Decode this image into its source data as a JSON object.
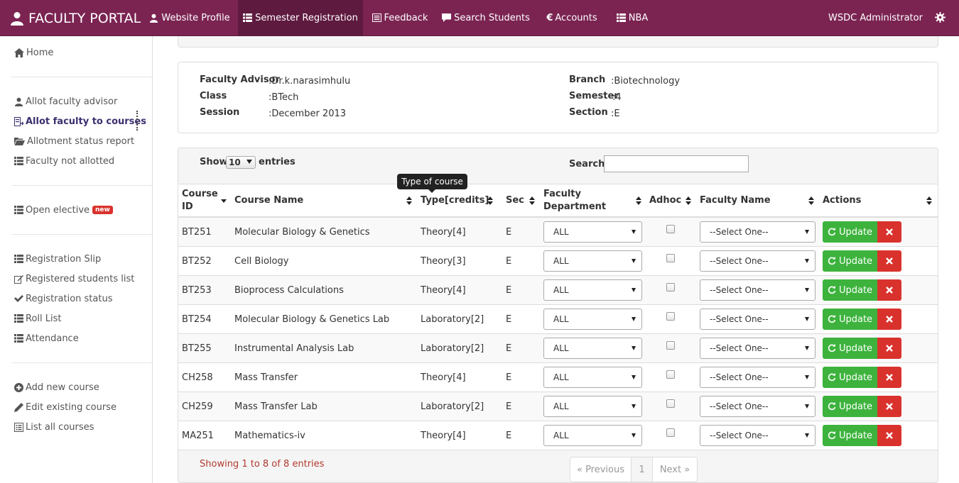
{
  "navbar": {
    "brand": "FACULTY PORTAL",
    "items": [
      {
        "label": "Website Profile",
        "icon": "user-icon"
      },
      {
        "label": "Semester Registration",
        "icon": "list-icon",
        "active": true
      },
      {
        "label": "Feedback",
        "icon": "form-icon"
      },
      {
        "label": "Search Students",
        "icon": "comment-icon"
      },
      {
        "label": "Accounts",
        "icon": "euro-icon"
      },
      {
        "label": "NBA",
        "icon": "list-icon"
      }
    ],
    "user": "WSDC Administrator",
    "accent": "#7b2452"
  },
  "sidebar": {
    "items": [
      {
        "label": "Home",
        "icon": "home-icon"
      },
      {
        "label": "Allot faculty advisor",
        "icon": "user-icon"
      },
      {
        "label": "Allot faculty to courses",
        "icon": "assign-icon",
        "active": true
      },
      {
        "label": "Allotment status report",
        "icon": "folder-open-icon"
      },
      {
        "label": "Faculty not allotted",
        "icon": "list-icon"
      },
      {
        "label": "Open elective",
        "icon": "list-icon",
        "badge": "new"
      },
      {
        "label": "Registration Slip",
        "icon": "list-icon"
      },
      {
        "label": "Registered students list",
        "icon": "edit-icon"
      },
      {
        "label": "Registration status",
        "icon": "check-icon"
      },
      {
        "label": "Roll List",
        "icon": "list-icon"
      },
      {
        "label": "Attendance",
        "icon": "list-icon"
      },
      {
        "label": "Add new course",
        "icon": "plus-circle-icon"
      },
      {
        "label": "Edit existing course",
        "icon": "pencil-icon"
      },
      {
        "label": "List all courses",
        "icon": "list-alt-icon"
      }
    ]
  },
  "info": {
    "faculty_advisor_label": "Faculty Advisor",
    "faculty_advisor": ":Dr.k.narasimhulu",
    "class_label": "Class",
    "class": ":BTech",
    "session_label": "Session",
    "session": ":December 2013",
    "branch_label": "Branch",
    "branch": ":Biotechnology",
    "semester_label": "Semester",
    "semester": ":4",
    "section_label": "Section",
    "section": ":E"
  },
  "table": {
    "show_label": "Show",
    "entries_value": "10",
    "entries_label": "entries",
    "search_label": "Search:",
    "search_value": "",
    "tooltip": "Type of course",
    "columns": [
      "Course ID",
      "Course Name",
      "Type[credits]",
      "Sec",
      "Faculty Department",
      "Adhoc",
      "Faculty Name",
      "Actions"
    ],
    "rows": [
      {
        "id": "BT251",
        "name": "Molecular Biology & Genetics",
        "type": "Theory[4]",
        "sec": "E",
        "dept": "ALL",
        "faculty": "--Select One--"
      },
      {
        "id": "BT252",
        "name": "Cell Biology",
        "type": "Theory[3]",
        "sec": "E",
        "dept": "ALL",
        "faculty": "--Select One--"
      },
      {
        "id": "BT253",
        "name": "Bioprocess Calculations",
        "type": "Theory[4]",
        "sec": "E",
        "dept": "ALL",
        "faculty": "--Select One--"
      },
      {
        "id": "BT254",
        "name": "Molecular Biology & Genetics Lab",
        "type": "Laboratory[2]",
        "sec": "E",
        "dept": "ALL",
        "faculty": "--Select One--"
      },
      {
        "id": "BT255",
        "name": "Instrumental Analysis Lab",
        "type": "Laboratory[2]",
        "sec": "E",
        "dept": "ALL",
        "faculty": "--Select One--"
      },
      {
        "id": "CH258",
        "name": "Mass Transfer",
        "type": "Theory[4]",
        "sec": "E",
        "dept": "ALL",
        "faculty": "--Select One--"
      },
      {
        "id": "CH259",
        "name": "Mass Transfer Lab",
        "type": "Laboratory[2]",
        "sec": "E",
        "dept": "ALL",
        "faculty": "--Select One--"
      },
      {
        "id": "MA251",
        "name": "Mathematics-iv",
        "type": "Theory[4]",
        "sec": "E",
        "dept": "ALL",
        "faculty": "--Select One--"
      }
    ],
    "update_label": "Update",
    "footer": "Showing 1 to 8 of 8 entries",
    "pager": {
      "prev": "« Previous",
      "page": "1",
      "next": "Next »"
    }
  }
}
